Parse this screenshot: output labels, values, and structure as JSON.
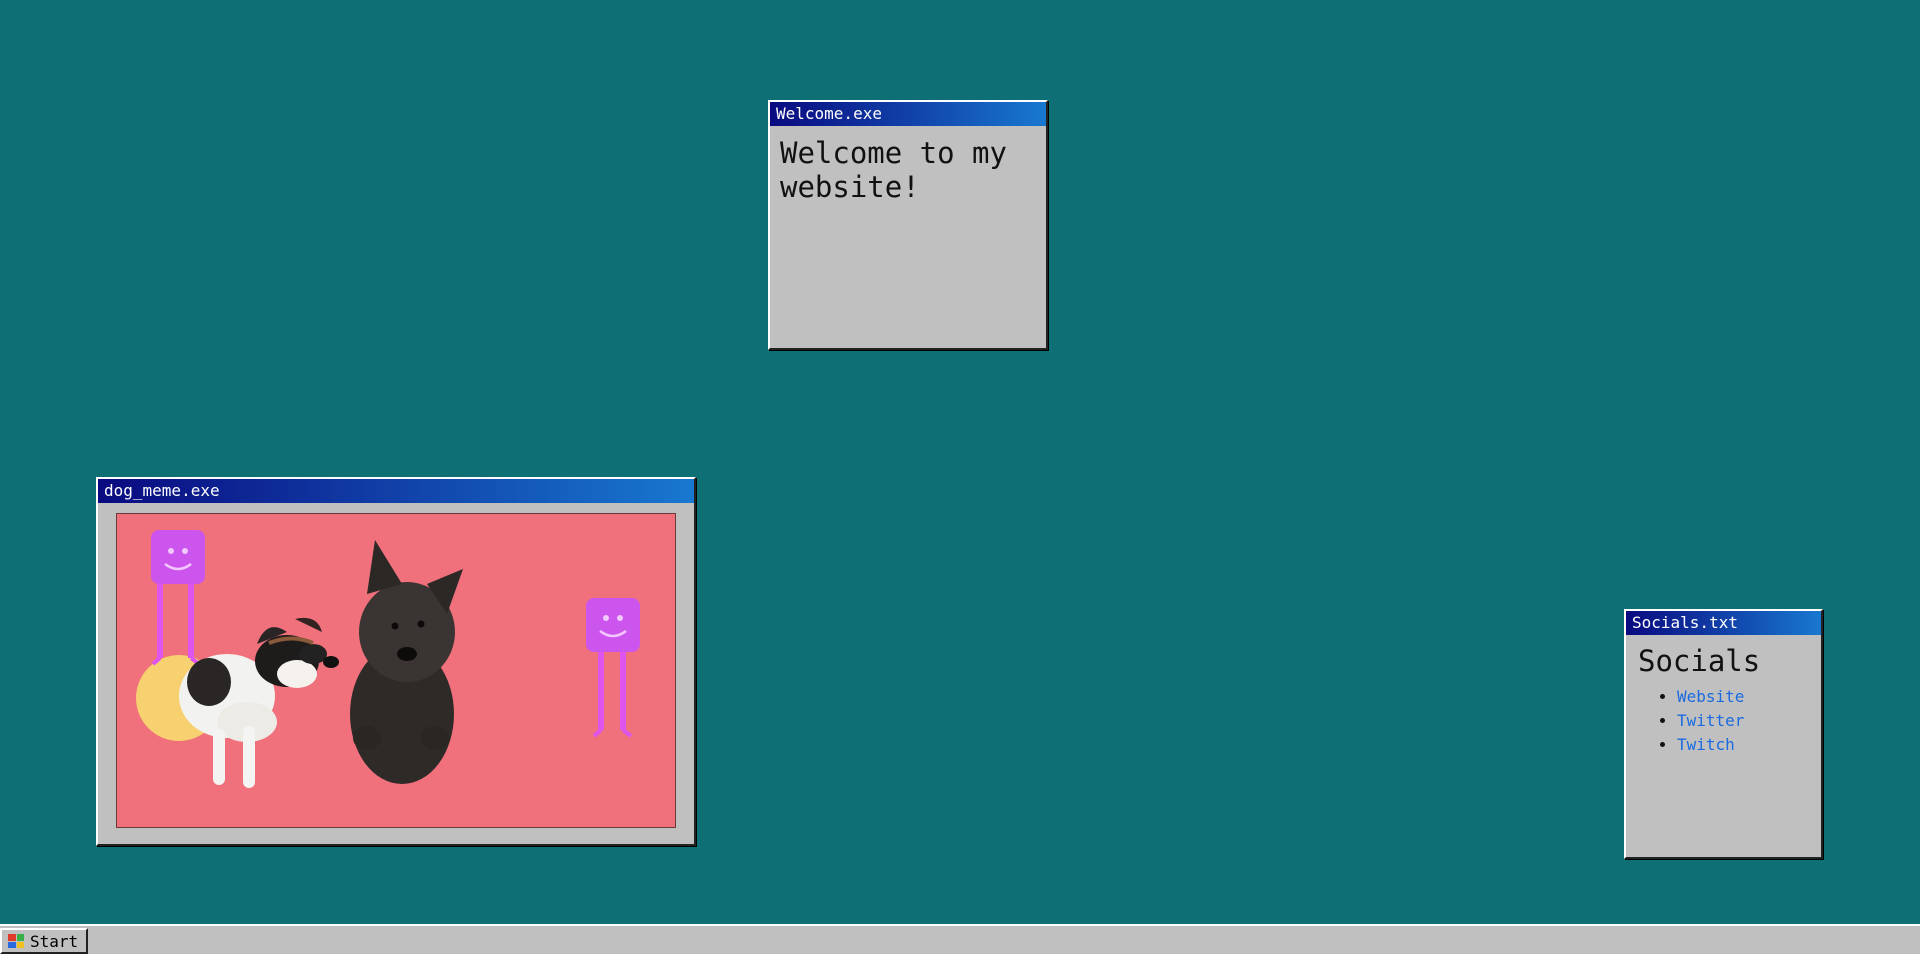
{
  "windows": {
    "welcome": {
      "title": "Welcome.exe",
      "text": "Welcome to my website!"
    },
    "dog_meme": {
      "title": "dog_meme.exe",
      "colors": {
        "background": "#f0707c",
        "creature": "#cc55ee",
        "sun": "#f7d070"
      }
    },
    "socials": {
      "title": "Socials.txt",
      "heading": "Socials",
      "links": [
        {
          "label": "Website"
        },
        {
          "label": "Twitter"
        },
        {
          "label": "Twitch"
        }
      ]
    }
  },
  "taskbar": {
    "start_label": "Start",
    "start_icon": "windows-logo-icon"
  },
  "colors": {
    "desktop": "#0e7074",
    "window_face": "#c0c0c0",
    "titlebar_start": "#0a0a80",
    "titlebar_end": "#1878d0",
    "link": "#1a6ae0"
  }
}
